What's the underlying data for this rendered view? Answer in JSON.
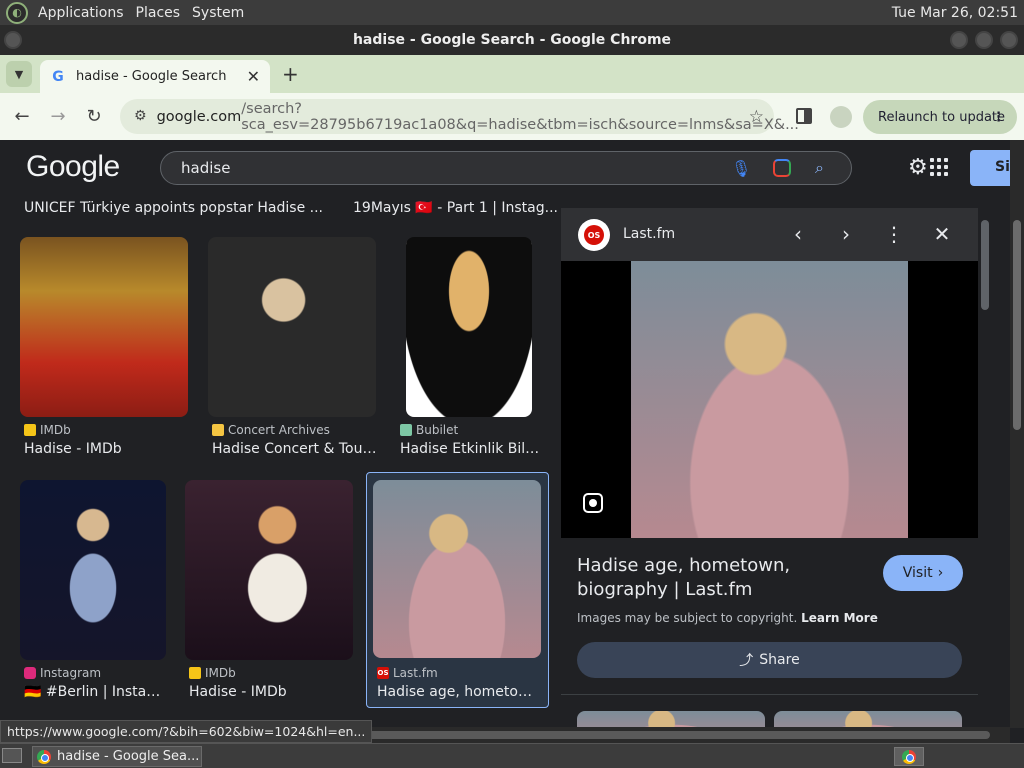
{
  "os": {
    "menus": [
      "Applications",
      "Places",
      "System"
    ],
    "clock": "Tue Mar 26, 02:51"
  },
  "window": {
    "title": "hadise - Google Search - Google Chrome"
  },
  "tab": {
    "title": "hadise - Google Search",
    "favicon": "G",
    "close": "✕",
    "new_tab": "+"
  },
  "toolbar": {
    "url_host": "google.com",
    "url_rest": "/search?sca_esv=28795b6719ac1a08&q=hadise&tbm=isch&source=lnms&sa=X&...",
    "relaunch": "Relaunch to update"
  },
  "google": {
    "logo": "Google",
    "query": "hadise",
    "signin": "Si"
  },
  "grid": {
    "top_captions": [
      "UNICEF Türkiye appoints popstar Hadise ...",
      "19Mayıs 🇹🇷 - Part 1 | Instag..."
    ],
    "results": [
      {
        "source": "IMDb",
        "title": "Hadise - IMDb",
        "fav_color": "#f5c518",
        "fav_text": ""
      },
      {
        "source": "Concert Archives",
        "title": "Hadise Concert & Tour ...",
        "fav_color": "#f5c542",
        "fav_text": ""
      },
      {
        "source": "Bubilet",
        "title": "Hadise Etkinlik Bilet...",
        "fav_color": "#7ec8a5",
        "fav_text": ""
      },
      {
        "source": "Instagram",
        "title": "🇩🇪 #Berlin | Instagr...",
        "fav_color": "#dd2a7b",
        "fav_text": ""
      },
      {
        "source": "IMDb",
        "title": "Hadise - IMDb",
        "fav_color": "#f5c518",
        "fav_text": ""
      },
      {
        "source": "Last.fm",
        "title": "Hadise age, hometown,...",
        "fav_color": "#d51007",
        "fav_text": "OS"
      }
    ]
  },
  "panel": {
    "site": "Last.fm",
    "favicon_text": "OS",
    "prev": "‹",
    "next": "›",
    "more": "⋮",
    "close": "✕",
    "title": "Hadise age, hometown, biography | Last.fm",
    "visit": "Visit",
    "visit_arrow": "›",
    "copyright": "Images may be subject to copyright.",
    "learn_more": "Learn More",
    "share": "Share"
  },
  "status_url": "https://www.google.com/?&bih=602&biw=1024&hl=en...",
  "taskbar": {
    "item": "hadise - Google Sea..."
  }
}
